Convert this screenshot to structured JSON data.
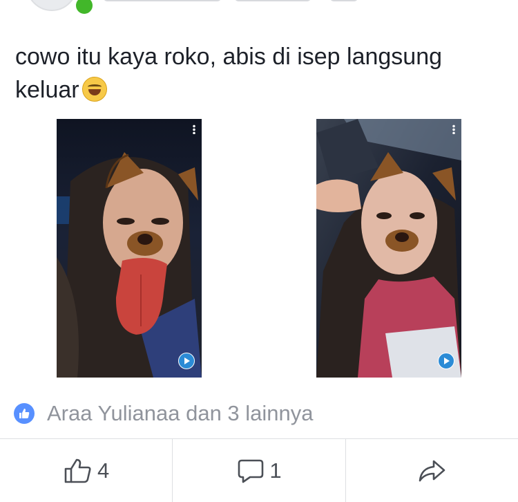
{
  "post": {
    "text": "cowo itu kaya roko, abis di isep langsung keluar",
    "emoji": "grinning-squinting-face"
  },
  "photos": [
    {
      "alt": "selfie with dog filter and tongue",
      "menu_icon": "vertical-dots-icon",
      "badge_icon": "play-icon"
    },
    {
      "alt": "selfie with dog filter",
      "menu_icon": "vertical-dots-icon",
      "badge_icon": "play-icon"
    }
  ],
  "reactions": {
    "icon": "like-icon",
    "text": "Araa Yulianaa dan 3 lainnya",
    "color": "#5890ff"
  },
  "actions": {
    "like_count": "4",
    "comment_count": "1",
    "like_icon": "thumbs-up-icon",
    "comment_icon": "speech-bubble-icon",
    "share_icon": "share-arrow-icon"
  },
  "colors": {
    "text": "#1d2129",
    "muted": "#90949c",
    "online": "#42b72a",
    "divider": "#dddfe2"
  }
}
